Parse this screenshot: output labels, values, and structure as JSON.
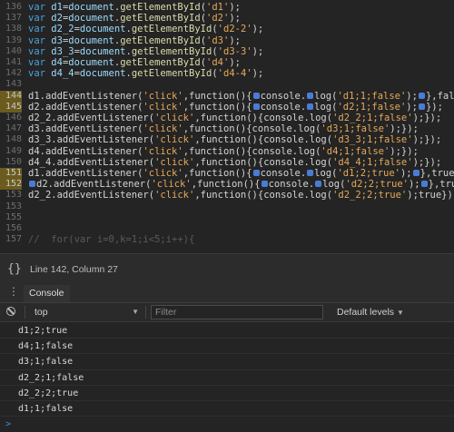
{
  "editor": {
    "lines": [
      {
        "num": "136",
        "hl": false,
        "segs": [
          [
            "kw",
            "var "
          ],
          [
            "id",
            "d1"
          ],
          [
            "plain",
            "="
          ],
          [
            "id",
            "document"
          ],
          [
            "plain",
            "."
          ],
          [
            "fn",
            "getElementById"
          ],
          [
            "plain",
            "("
          ],
          [
            "str",
            "'d1'"
          ],
          [
            "plain",
            ");"
          ]
        ]
      },
      {
        "num": "137",
        "hl": false,
        "segs": [
          [
            "kw",
            "var "
          ],
          [
            "id",
            "d2"
          ],
          [
            "plain",
            "="
          ],
          [
            "id",
            "document"
          ],
          [
            "plain",
            "."
          ],
          [
            "fn",
            "getElementById"
          ],
          [
            "plain",
            "("
          ],
          [
            "str",
            "'d2'"
          ],
          [
            "plain",
            ");"
          ]
        ]
      },
      {
        "num": "138",
        "hl": false,
        "segs": [
          [
            "kw",
            "var "
          ],
          [
            "id",
            "d2_2"
          ],
          [
            "plain",
            "="
          ],
          [
            "id",
            "document"
          ],
          [
            "plain",
            "."
          ],
          [
            "fn",
            "getElementById"
          ],
          [
            "plain",
            "("
          ],
          [
            "str",
            "'d2-2'"
          ],
          [
            "plain",
            ");"
          ]
        ]
      },
      {
        "num": "139",
        "hl": false,
        "segs": [
          [
            "kw",
            "var "
          ],
          [
            "id",
            "d3"
          ],
          [
            "plain",
            "="
          ],
          [
            "id",
            "document"
          ],
          [
            "plain",
            "."
          ],
          [
            "fn",
            "getElementById"
          ],
          [
            "plain",
            "("
          ],
          [
            "str",
            "'d3'"
          ],
          [
            "plain",
            ");"
          ]
        ]
      },
      {
        "num": "140",
        "hl": false,
        "segs": [
          [
            "kw",
            "var "
          ],
          [
            "id",
            "d3_3"
          ],
          [
            "plain",
            "="
          ],
          [
            "id",
            "document"
          ],
          [
            "plain",
            "."
          ],
          [
            "fn",
            "getElementById"
          ],
          [
            "plain",
            "("
          ],
          [
            "str",
            "'d3-3'"
          ],
          [
            "plain",
            ");"
          ]
        ]
      },
      {
        "num": "141",
        "hl": false,
        "segs": [
          [
            "kw",
            "var "
          ],
          [
            "id",
            "d4"
          ],
          [
            "plain",
            "="
          ],
          [
            "id",
            "document"
          ],
          [
            "plain",
            "."
          ],
          [
            "fn",
            "getElementById"
          ],
          [
            "plain",
            "("
          ],
          [
            "str",
            "'d4'"
          ],
          [
            "plain",
            ");"
          ]
        ]
      },
      {
        "num": "142",
        "hl": false,
        "segs": [
          [
            "kw",
            "var "
          ],
          [
            "id",
            "d4_4"
          ],
          [
            "plain",
            "="
          ],
          [
            "id",
            "document"
          ],
          [
            "plain",
            "."
          ],
          [
            "fn",
            "getElementById"
          ],
          [
            "plain",
            "("
          ],
          [
            "str",
            "'d4-4'"
          ],
          [
            "plain",
            ");"
          ]
        ]
      },
      {
        "num": "143",
        "hl": false,
        "segs": []
      },
      {
        "num": "144",
        "hl": true,
        "segs": [
          [
            "plain",
            "d1.addEventListener("
          ],
          [
            "str",
            "'click'"
          ],
          [
            "plain",
            ",function(){"
          ],
          [
            "bp",
            ""
          ],
          [
            "plain",
            "console."
          ],
          [
            "bp",
            ""
          ],
          [
            "plain",
            "log("
          ],
          [
            "str",
            "'d1;1;false'"
          ],
          [
            "plain",
            ");"
          ],
          [
            "bp",
            ""
          ],
          [
            "plain",
            "},false);"
          ]
        ]
      },
      {
        "num": "145",
        "hl": true,
        "segs": [
          [
            "plain",
            "d2.addEventListener("
          ],
          [
            "str",
            "'click'"
          ],
          [
            "plain",
            ",function(){"
          ],
          [
            "bp",
            ""
          ],
          [
            "plain",
            "console."
          ],
          [
            "bp",
            ""
          ],
          [
            "plain",
            "log("
          ],
          [
            "str",
            "'d2;1;false'"
          ],
          [
            "plain",
            ");"
          ],
          [
            "bp",
            ""
          ],
          [
            "plain",
            "});"
          ]
        ]
      },
      {
        "num": "146",
        "hl": false,
        "segs": [
          [
            "plain",
            "d2_2.addEventListener("
          ],
          [
            "str",
            "'click'"
          ],
          [
            "plain",
            ",function(){console.log("
          ],
          [
            "str",
            "'d2_2;1;false'"
          ],
          [
            "plain",
            ");});"
          ]
        ]
      },
      {
        "num": "147",
        "hl": false,
        "segs": [
          [
            "plain",
            "d3.addEventListener("
          ],
          [
            "str",
            "'click'"
          ],
          [
            "plain",
            ",function(){console.log("
          ],
          [
            "str",
            "'d3;1;false'"
          ],
          [
            "plain",
            ");});"
          ]
        ]
      },
      {
        "num": "148",
        "hl": false,
        "segs": [
          [
            "plain",
            "d3_3.addEventListener("
          ],
          [
            "str",
            "'click'"
          ],
          [
            "plain",
            ",function(){console.log("
          ],
          [
            "str",
            "'d3_3;1;false'"
          ],
          [
            "plain",
            ");});"
          ]
        ]
      },
      {
        "num": "149",
        "hl": false,
        "segs": [
          [
            "plain",
            "d4.addEventListener("
          ],
          [
            "str",
            "'click'"
          ],
          [
            "plain",
            ",function(){console.log("
          ],
          [
            "str",
            "'d4;1;false'"
          ],
          [
            "plain",
            ");});"
          ]
        ]
      },
      {
        "num": "150",
        "hl": false,
        "segs": [
          [
            "plain",
            "d4_4.addEventListener("
          ],
          [
            "str",
            "'click'"
          ],
          [
            "plain",
            ",function(){console.log("
          ],
          [
            "str",
            "'d4_4;1;false'"
          ],
          [
            "plain",
            ");});"
          ]
        ]
      },
      {
        "num": "151",
        "hl": true,
        "segs": [
          [
            "plain",
            "d1.addEventListener("
          ],
          [
            "str",
            "'click'"
          ],
          [
            "plain",
            ",function(){"
          ],
          [
            "bp",
            ""
          ],
          [
            "plain",
            "console."
          ],
          [
            "bp",
            ""
          ],
          [
            "plain",
            "log("
          ],
          [
            "str",
            "'d1;2;true'"
          ],
          [
            "plain",
            ");"
          ],
          [
            "bp",
            ""
          ],
          [
            "plain",
            "},true);"
          ]
        ]
      },
      {
        "num": "152",
        "hl": true,
        "segs": [
          [
            "bp",
            ""
          ],
          [
            "plain",
            "d2.addEventListener("
          ],
          [
            "str",
            "'click'"
          ],
          [
            "plain",
            ",function(){"
          ],
          [
            "bp",
            ""
          ],
          [
            "plain",
            "console."
          ],
          [
            "bp",
            ""
          ],
          [
            "plain",
            "log("
          ],
          [
            "str",
            "'d2;2;true'"
          ],
          [
            "plain",
            ");"
          ],
          [
            "bp",
            ""
          ],
          [
            "plain",
            "},true);"
          ]
        ]
      },
      {
        "num": "153",
        "hl": false,
        "segs": [
          [
            "plain",
            "d2_2.addEventListener("
          ],
          [
            "str",
            "'click'"
          ],
          [
            "plain",
            ",function(){console.log("
          ],
          [
            "str",
            "'d2_2;2;true'"
          ],
          [
            "plain",
            ");true});"
          ]
        ]
      },
      {
        "num": "153",
        "hl": false,
        "segs": []
      },
      {
        "num": "155",
        "hl": false,
        "segs": []
      },
      {
        "num": "156",
        "hl": false,
        "segs": []
      },
      {
        "num": "157",
        "hl": false,
        "segs": [
          [
            "dim",
            "//  for(var i=0,k=1;i<5;i++){"
          ]
        ]
      }
    ]
  },
  "status": {
    "braces": "{}",
    "position": "Line 142, Column 27"
  },
  "drawer": {
    "menu_icon": "⋮",
    "tab_label": "Console"
  },
  "toolbar": {
    "context": "top",
    "filter_placeholder": "Filter",
    "levels": "Default levels"
  },
  "console": {
    "logs": [
      "d1;2;true",
      "d4;1;false",
      "d3;1;false",
      "d2_2;1;false",
      "d2_2;2;true",
      "d1;1;false"
    ],
    "prompt": ">"
  }
}
